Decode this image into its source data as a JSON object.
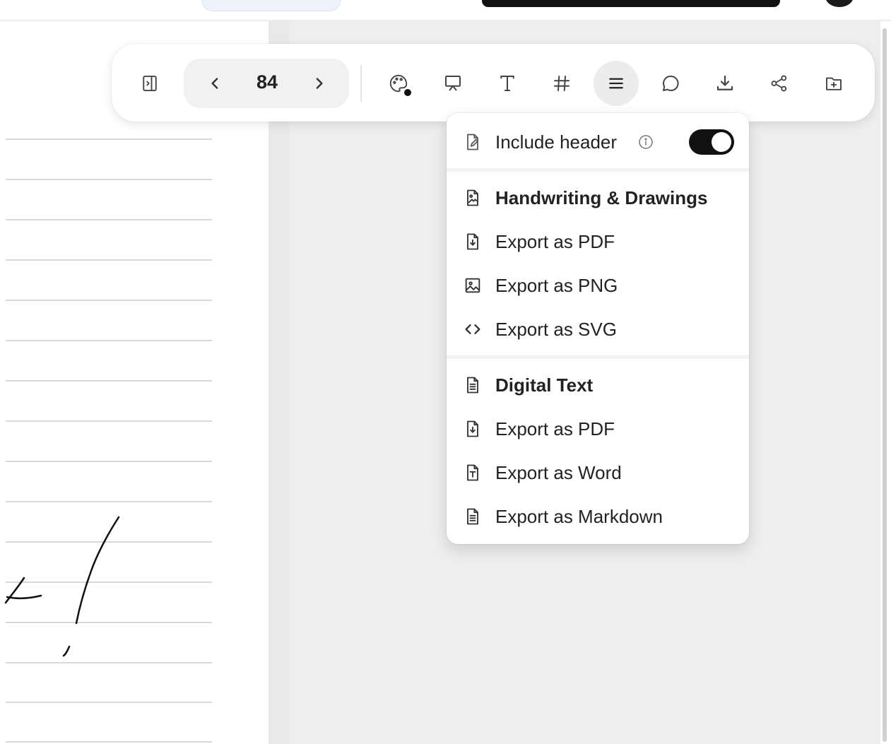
{
  "toolbar": {
    "page_number": "84",
    "buttons": [
      {
        "name": "sidebar-toggle",
        "icon": "sidebar-panel-icon"
      },
      {
        "name": "prev-page",
        "icon": "chevron-left-icon"
      },
      {
        "name": "next-page",
        "icon": "chevron-right-icon"
      },
      {
        "name": "palette",
        "icon": "palette-icon"
      },
      {
        "name": "presentation",
        "icon": "presentation-icon"
      },
      {
        "name": "text-tool",
        "icon": "text-icon"
      },
      {
        "name": "hashtag",
        "icon": "hashtag-icon"
      },
      {
        "name": "menu",
        "icon": "hamburger-menu-icon",
        "active": true
      },
      {
        "name": "comment",
        "icon": "speech-bubble-icon"
      },
      {
        "name": "download",
        "icon": "download-icon"
      },
      {
        "name": "share",
        "icon": "share-icon"
      },
      {
        "name": "add-to-folder",
        "icon": "folder-plus-icon"
      }
    ]
  },
  "export_menu": {
    "include_header": {
      "label": "Include header",
      "enabled": true
    },
    "sections": [
      {
        "title": "Handwriting & Drawings",
        "items": [
          {
            "label": "Export as PDF",
            "icon": "file-download-icon"
          },
          {
            "label": "Export as PNG",
            "icon": "image-icon"
          },
          {
            "label": "Export as SVG",
            "icon": "code-brackets-icon"
          }
        ]
      },
      {
        "title": "Digital Text",
        "items": [
          {
            "label": "Export as PDF",
            "icon": "file-download-icon"
          },
          {
            "label": "Export as Word",
            "icon": "file-text-icon"
          },
          {
            "label": "Export as Markdown",
            "icon": "file-lines-icon"
          }
        ]
      }
    ]
  },
  "colors": {
    "accent": "#111111",
    "toolbar_bg": "#ffffff",
    "canvas_bg": "#eeeeee",
    "active_button_bg": "#ececec"
  }
}
